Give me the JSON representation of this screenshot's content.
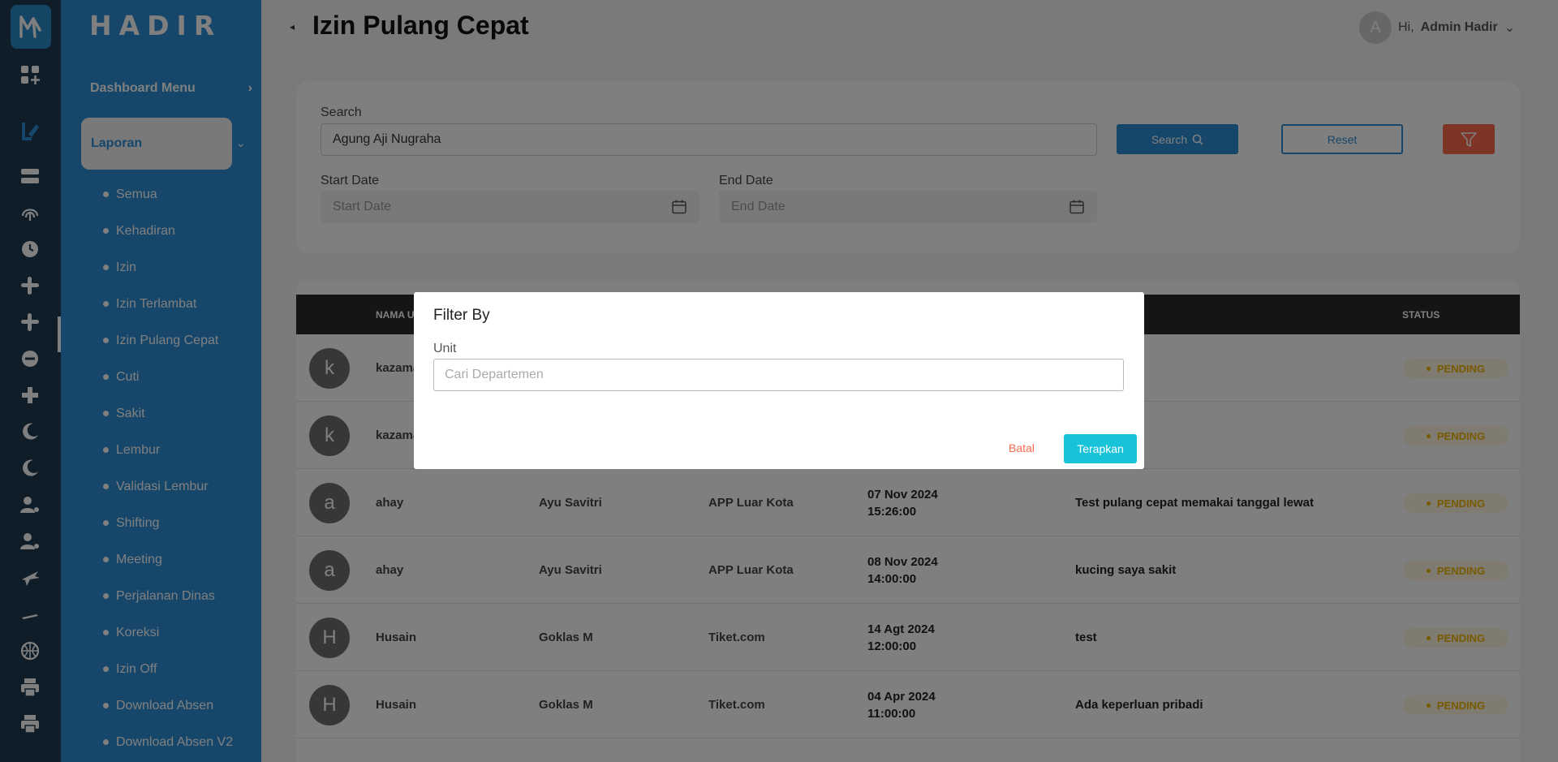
{
  "app": {
    "brand": "HADIR"
  },
  "rail_icons": [
    "add-widget-icon",
    "report-icon",
    "storage-icon",
    "fingerprint-icon",
    "clock-icon",
    "slack-icon",
    "slack-icon",
    "minus-circle-icon",
    "plus-icon",
    "moon-icon",
    "moon-icon",
    "user-settings-icon",
    "user-settings-icon",
    "plane-icon",
    "plane-land-icon",
    "basketball-icon",
    "printer-icon",
    "printer-icon"
  ],
  "sidebar": {
    "dashboard_label": "Dashboard Menu",
    "laporan_label": "Laporan",
    "items": [
      "Semua",
      "Kehadiran",
      "Izin",
      "Izin Terlambat",
      "Izin Pulang Cepat",
      "Cuti",
      "Sakit",
      "Lembur",
      "Validasi Lembur",
      "Shifting",
      "Meeting",
      "Perjalanan Dinas",
      "Koreksi",
      "Izin Off",
      "Download Absen",
      "Download Absen V2"
    ]
  },
  "header": {
    "title": "Izin Pulang Cepat",
    "user_avatar": "A",
    "user_greeting": "Hi,",
    "user_name": "Admin Hadir"
  },
  "filters": {
    "search_label": "Search",
    "search_value": "Agung Aji Nugraha",
    "search_button": "Search",
    "reset_button": "Reset",
    "start_label": "Start Date",
    "start_placeholder": "Start Date",
    "end_label": "End Date",
    "end_placeholder": "End Date"
  },
  "table": {
    "headers": {
      "nama": "NAMA U",
      "status": "STATUS"
    },
    "rows": [
      {
        "avatar": "k",
        "user": "kazama",
        "nama": "",
        "unit": "",
        "tgl": "",
        "jam": "",
        "alasan": "",
        "status": "PENDING"
      },
      {
        "avatar": "k",
        "user": "kazama",
        "nama": "",
        "unit": "",
        "tgl": "",
        "jam": "",
        "alasan": "",
        "status": "PENDING"
      },
      {
        "avatar": "a",
        "user": "ahay",
        "nama": "Ayu Savitri",
        "unit": "APP Luar Kota",
        "tgl": "07 Nov 2024",
        "jam": "15:26:00",
        "alasan": "Test pulang cepat memakai tanggal lewat",
        "status": "PENDING"
      },
      {
        "avatar": "a",
        "user": "ahay",
        "nama": "Ayu Savitri",
        "unit": "APP Luar Kota",
        "tgl": "08 Nov 2024",
        "jam": "14:00:00",
        "alasan": "kucing saya sakit",
        "status": "PENDING"
      },
      {
        "avatar": "H",
        "user": "Husain",
        "nama": "Goklas M",
        "unit": "Tiket.com",
        "tgl": "14 Agt 2024",
        "jam": "12:00:00",
        "alasan": "test",
        "status": "PENDING"
      },
      {
        "avatar": "H",
        "user": "Husain",
        "nama": "Goklas M",
        "unit": "Tiket.com",
        "tgl": "04 Apr 2024",
        "jam": "11:00:00",
        "alasan": "Ada keperluan pribadi",
        "status": "PENDING"
      }
    ]
  },
  "modal": {
    "title": "Filter By",
    "unit_label": "Unit",
    "unit_placeholder": "Cari Departemen",
    "cancel": "Batal",
    "apply": "Terapkan"
  },
  "colors": {
    "sidebar": "#2c8fd6",
    "rail": "#1f3a52",
    "filter_button": "#ff6a4d",
    "apply_button": "#17c3d8",
    "pending": "#f0b400"
  }
}
